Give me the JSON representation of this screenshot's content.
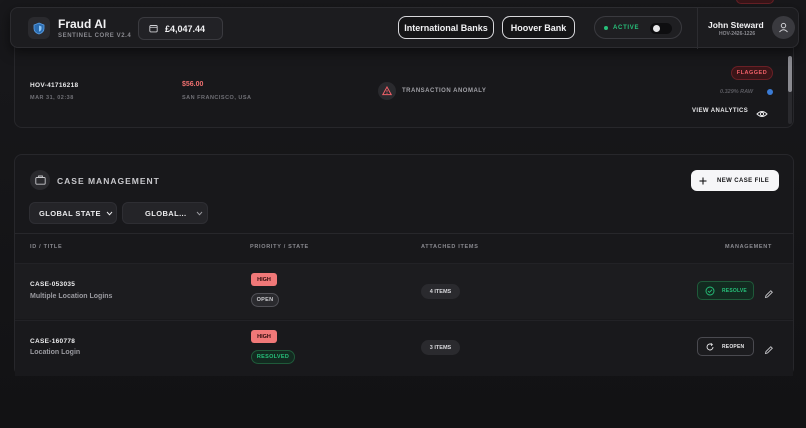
{
  "header": {
    "app_title": "Fraud AI",
    "app_subtitle": "SENTINEL CORE V2.4",
    "balance": "£4,047.44",
    "bank_buttons": [
      "International Banks",
      "Hoover Bank"
    ],
    "status": "ACTIVE",
    "user": {
      "name": "John Steward",
      "id": "HOV-2426-1226"
    }
  },
  "transaction": {
    "id": "HOV-41716218",
    "date": "MAR 31, 02:38",
    "amount": "$56.00",
    "location": "SAN FRANCISCO, USA",
    "type": "TRANSACTION ANOMALY",
    "status": "FLAGGED",
    "raw_score": "0.329% RAW",
    "view_analytics": "VIEW ANALYTICS"
  },
  "case_management": {
    "title": "CASE MANAGEMENT",
    "new_case_label": "NEW CASE FILE",
    "filters": [
      "GLOBAL STATE",
      "GLOBAL..."
    ],
    "columns": [
      "ID / TITLE",
      "PRIORITY / STATE",
      "ATTACHED ITEMS",
      "MANAGEMENT"
    ],
    "rows": [
      {
        "id": "CASE-053035",
        "title": "Multiple Location Logins",
        "priority": "HIGH",
        "state": "OPEN",
        "items": "4 ITEMS",
        "action": "RESOLVE"
      },
      {
        "id": "CASE-160778",
        "title": "Location Login",
        "priority": "HIGH",
        "state": "RESOLVED",
        "items": "3 ITEMS",
        "action": "REOPEN"
      }
    ]
  },
  "colors": {
    "accent_green": "#27c07a",
    "danger": "#f07878",
    "accent_blue": "#3a7bd5"
  }
}
